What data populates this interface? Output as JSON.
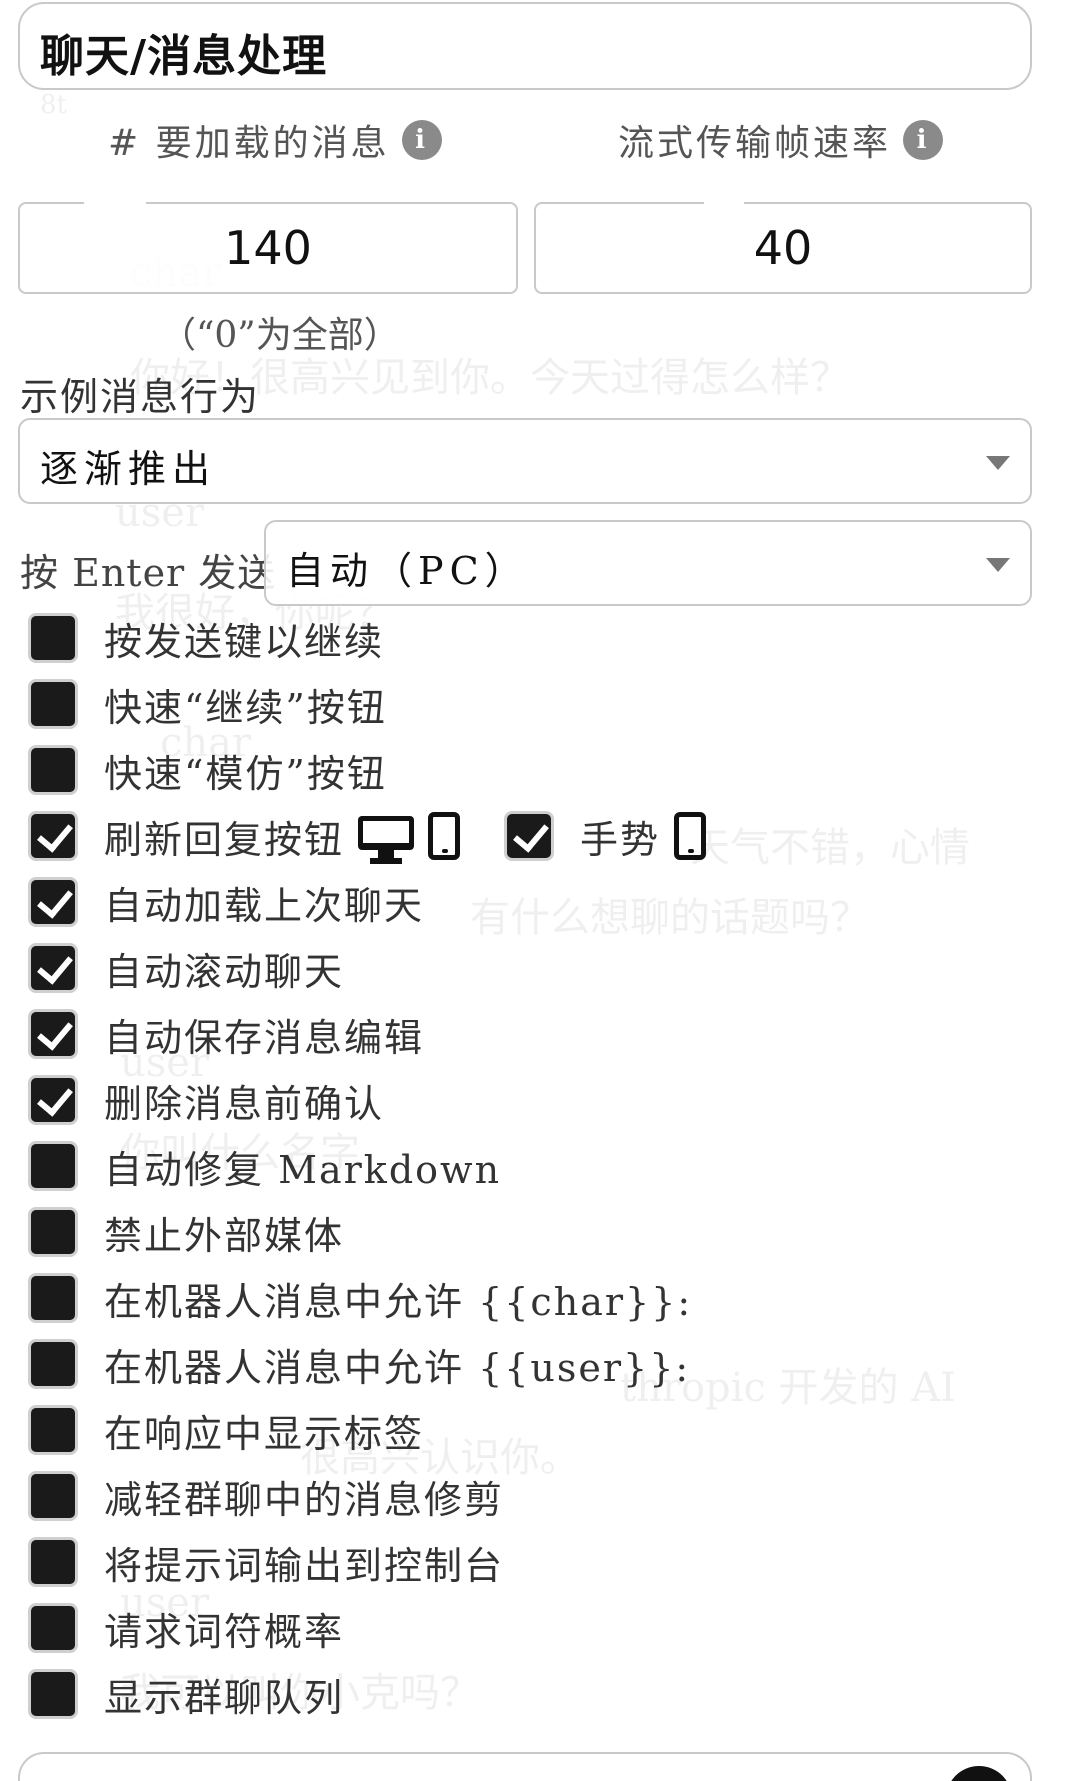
{
  "section": {
    "title": "聊天/消息处理"
  },
  "messages_to_load": {
    "label": "# 要加载的消息",
    "value": "140",
    "note": "（“0”为全部）"
  },
  "stream_fps": {
    "label": "流式传输帧速率",
    "value": "40"
  },
  "example_behavior": {
    "label": "示例消息行为",
    "selected": "逐渐推出"
  },
  "enter_send": {
    "label": "按 Enter 发送",
    "selected": "自动（PC）"
  },
  "checkboxes": [
    {
      "label": "按发送键以继续",
      "checked": false
    },
    {
      "label": "快速“继续”按钮",
      "checked": false
    },
    {
      "label": "快速“模仿”按钮",
      "checked": false
    },
    {
      "label": "刷新回复按钮",
      "checked": true
    },
    {
      "label": "自动加载上次聊天",
      "checked": true
    },
    {
      "label": "自动滚动聊天",
      "checked": true
    },
    {
      "label": "自动保存消息编辑",
      "checked": true
    },
    {
      "label": "删除消息前确认",
      "checked": true
    },
    {
      "label": "自动修复 Markdown",
      "checked": false
    },
    {
      "label": "禁止外部媒体",
      "checked": false
    },
    {
      "label": "在机器人消息中允许 {{char}}:",
      "checked": false
    },
    {
      "label": "在机器人消息中允许 {{user}}:",
      "checked": false
    },
    {
      "label": "在响应中显示标签",
      "checked": false
    },
    {
      "label": "减轻群聊中的消息修剪",
      "checked": false
    },
    {
      "label": "将提示词输出到控制台",
      "checked": false
    },
    {
      "label": "请求词符概率",
      "checked": false
    },
    {
      "label": "显示群聊队列",
      "checked": false
    }
  ],
  "gesture": {
    "label": "手势",
    "checked": true
  },
  "icons": {
    "info": "info-icon",
    "desktop": "desktop-icon",
    "mobile": "mobile-icon",
    "caret": "chevron-down-icon"
  },
  "ghost": {
    "line1": "你好！很高兴见到你。今天过得怎么样？",
    "line2": "我很好，你呢？",
    "line3": "天气不错，心情",
    "line4": "有什么想聊的话题吗？",
    "line5": "你叫什么名字",
    "line6": "thropic 开发的 AI",
    "line7": "很高兴认识你。",
    "line8": "我可以叫你小克吗？",
    "name1": "char",
    "name2": "user"
  }
}
